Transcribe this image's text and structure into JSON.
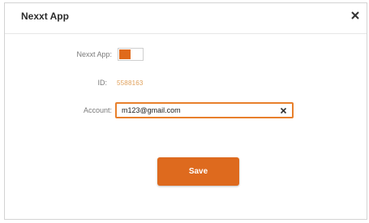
{
  "dialog": {
    "title": "Nexxt App"
  },
  "form": {
    "toggle_label": "Nexxt App:",
    "toggle_on": true,
    "id_label": "ID:",
    "id_value": "5588163",
    "account_label": "Account:",
    "account_value": "m123@gmail.com"
  },
  "actions": {
    "save_label": "Save"
  },
  "colors": {
    "accent": "#de6a1e",
    "field_border": "#e8802c",
    "id_value": "#e0a05a"
  }
}
